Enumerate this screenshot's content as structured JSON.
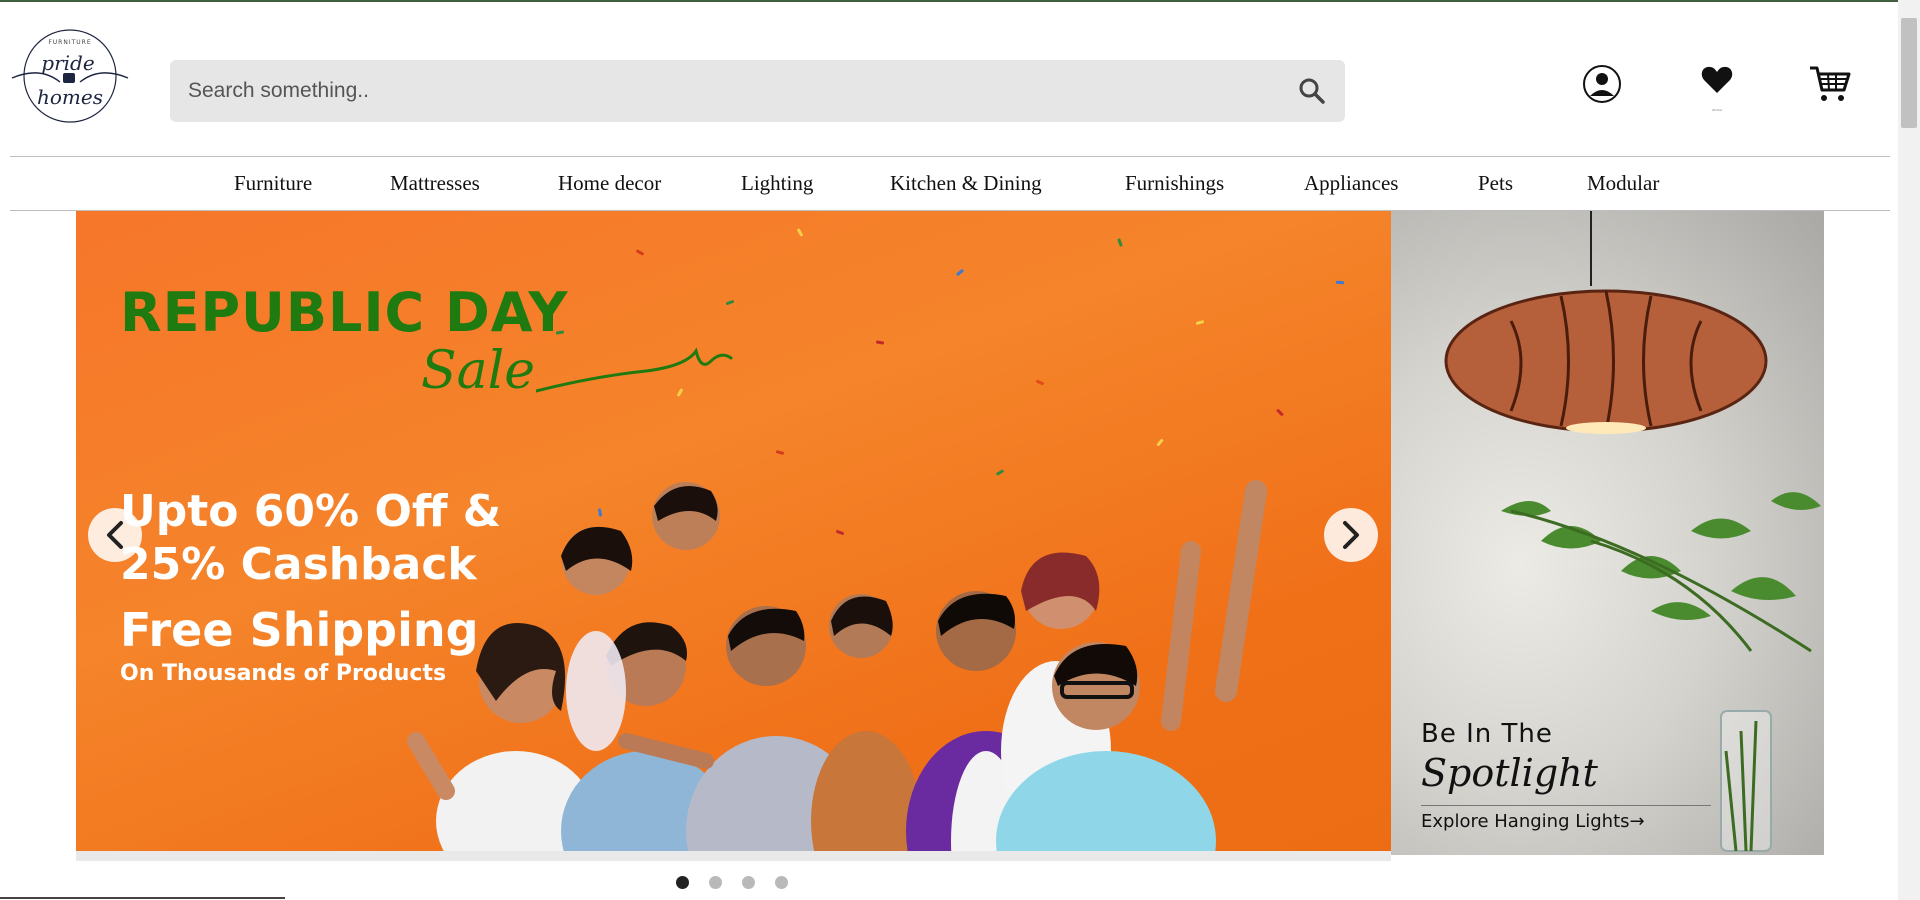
{
  "brand": {
    "logo_top": "FURNITURE",
    "logo_line1": "pride",
    "logo_line2": "homes"
  },
  "search": {
    "placeholder": "Search something..",
    "icon": "search-icon"
  },
  "header_icons": [
    {
      "name": "user-icon",
      "label": "."
    },
    {
      "name": "heart-icon",
      "label": "Wishlist"
    },
    {
      "name": "cart-icon",
      "label": ""
    }
  ],
  "nav": {
    "items": [
      {
        "label": "Furniture"
      },
      {
        "label": "Mattresses"
      },
      {
        "label": "Home decor"
      },
      {
        "label": "Lighting"
      },
      {
        "label": "Kitchen & Dining"
      },
      {
        "label": "Furnishings"
      },
      {
        "label": "Appliances"
      },
      {
        "label": "Pets"
      },
      {
        "label": "Modular"
      }
    ]
  },
  "hero": {
    "title": "REPUBLIC DAY",
    "script": "Sale",
    "line1": "Upto 60% Off &",
    "line2": "25% Cashback",
    "line3": "Free Shipping",
    "line4": "On Thousands of Products",
    "prev_icon": "chevron-left-icon",
    "next_icon": "chevron-right-icon",
    "slides_total": 4,
    "active_slide": 1
  },
  "side_banner": {
    "line1": "Be In The",
    "line2": "Spotlight",
    "cta": "Explore Hanging Lights→"
  },
  "colors": {
    "hero_orange": "#f5842a",
    "hero_green": "#1f7a10",
    "search_bg": "#e6e6e6"
  }
}
